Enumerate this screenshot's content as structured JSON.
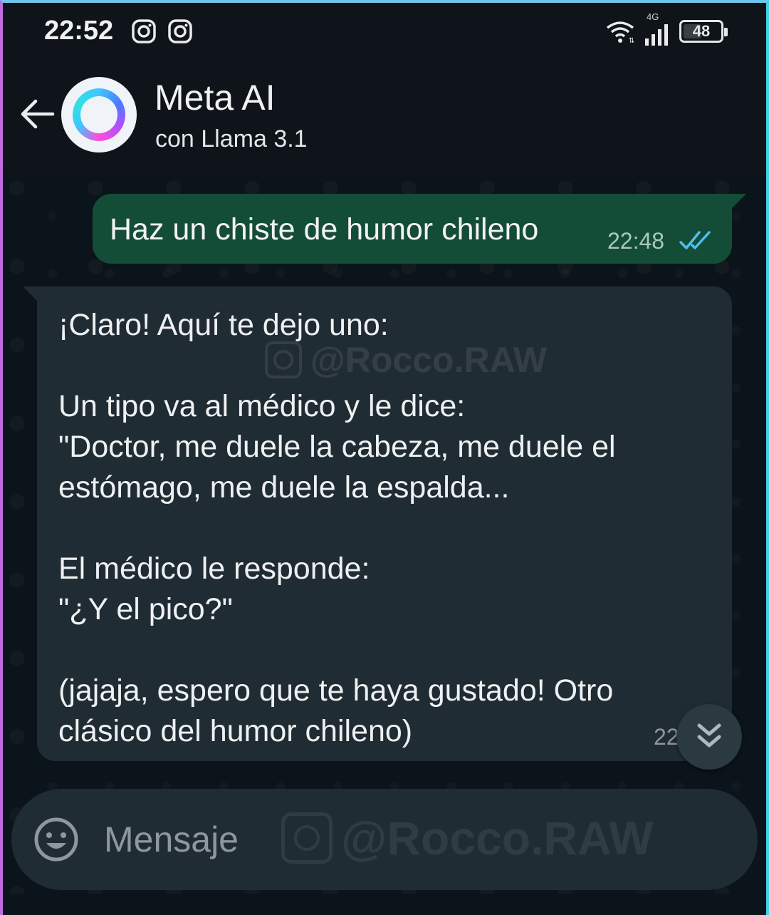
{
  "status_bar": {
    "time": "22:52",
    "network_type": "4G",
    "battery_level": "48",
    "icons": [
      "instagram-icon",
      "instagram-icon",
      "wifi-icon",
      "cellular-signal-icon",
      "battery-icon"
    ]
  },
  "header": {
    "contact_name": "Meta AI",
    "contact_subtitle": "con Llama 3.1",
    "icons": [
      "back-arrow-icon",
      "meta-ai-ring-icon"
    ]
  },
  "messages": [
    {
      "direction": "outgoing",
      "text": "Haz un chiste de humor chileno",
      "time": "22:48",
      "status": "read",
      "status_icon": "double-check-icon"
    },
    {
      "direction": "incoming",
      "text": "¡Claro! Aquí te dejo uno:\n\nUn tipo va al médico y le dice:\n\"Doctor, me duele la cabeza, me duele el estómago, me duele la espalda...\n\nEl médico le responde:\n\"¿Y el pico?\"\n\n(jajaja, espero que te haya gustado! Otro clásico del humor chileno)",
      "time": "22"
    }
  ],
  "watermark": "@Rocco.RAW",
  "composer": {
    "placeholder": "Mensaje",
    "icons": [
      "emoji-icon",
      "scroll-down-icon"
    ]
  },
  "colors": {
    "background": "#0b141a",
    "outgoing_bubble": "#144d37",
    "incoming_bubble": "#202c33",
    "read_ticks": "#53bdeb"
  }
}
